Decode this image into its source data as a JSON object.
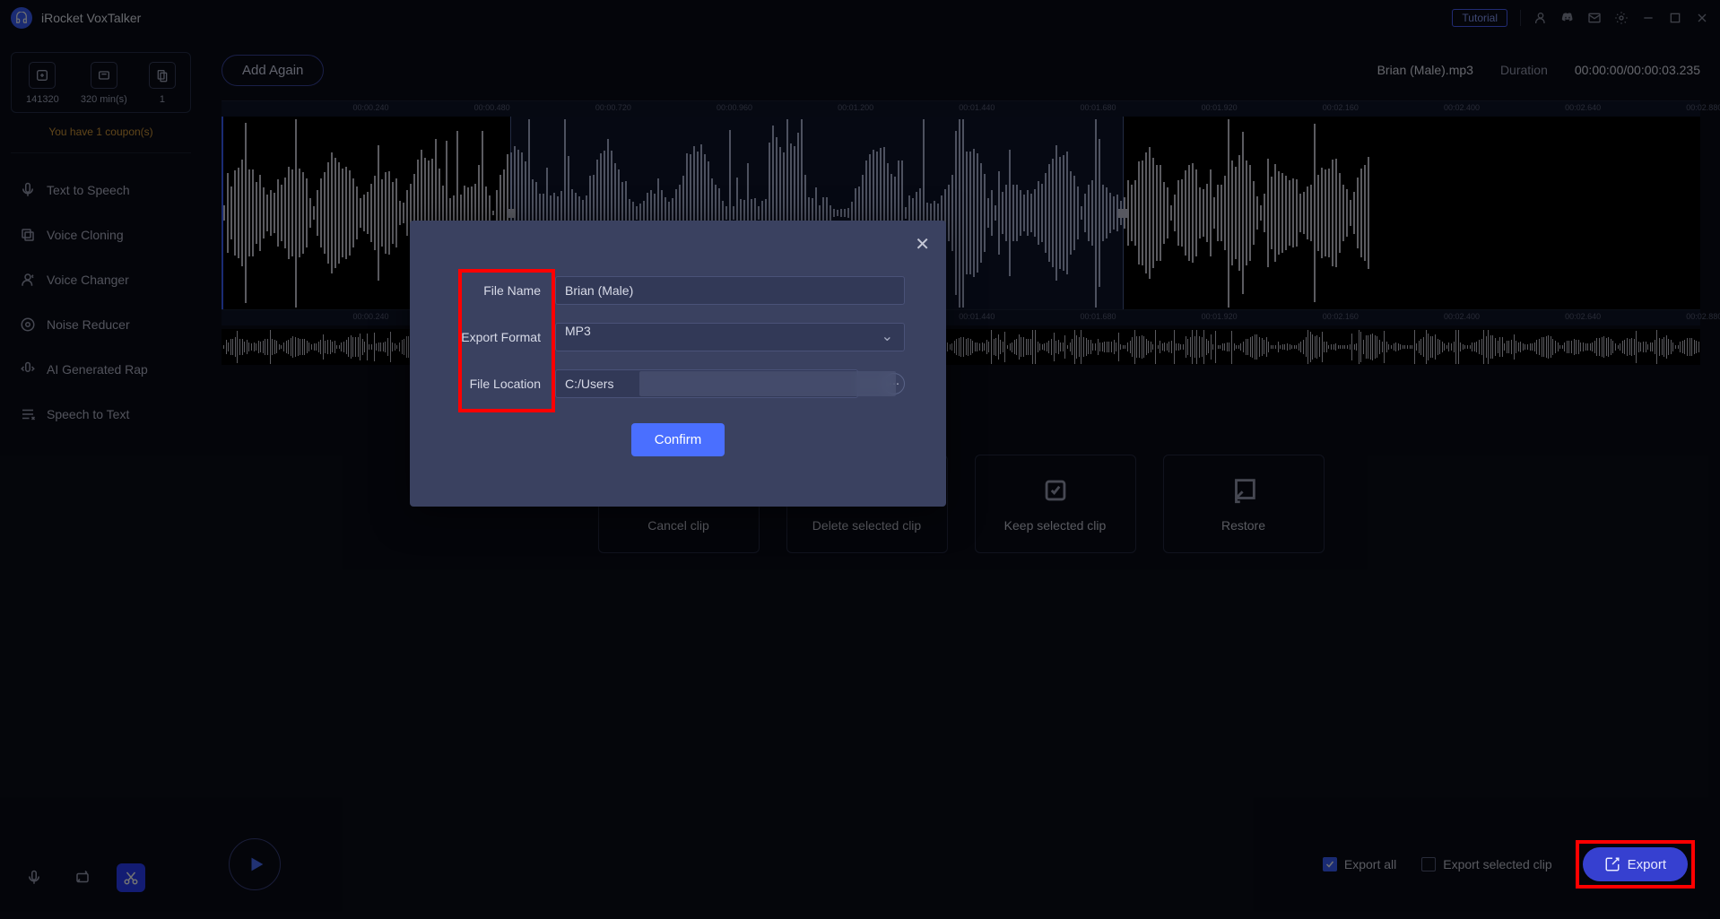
{
  "app_title": "iRocket VoxTalker",
  "titlebar": {
    "tutorial": "Tutorial"
  },
  "sidebar": {
    "stats": [
      {
        "value": "141320"
      },
      {
        "value": "320 min(s)"
      },
      {
        "value": "1"
      }
    ],
    "coupon": "You have 1 coupon(s)",
    "items": [
      {
        "label": "Text to Speech"
      },
      {
        "label": "Voice Cloning"
      },
      {
        "label": "Voice Changer"
      },
      {
        "label": "Noise Reducer"
      },
      {
        "label": "AI Generated Rap"
      },
      {
        "label": "Speech to Text"
      }
    ]
  },
  "header": {
    "add_again": "Add Again",
    "file_name": "Brian (Male).mp3",
    "duration_label": "Duration",
    "duration_value": "00:00:00/00:00:03.235"
  },
  "timeline_ticks": [
    "00:00.240",
    "00:00.480",
    "00:00.720",
    "00:00.960",
    "00:01.200",
    "00:01.440",
    "00:01.680",
    "00:01.920",
    "00:02.160",
    "00:02.400",
    "00:02.640",
    "00:02.880"
  ],
  "actions": {
    "cancel": "Cancel clip",
    "delete": "Delete selected clip",
    "keep": "Keep selected clip",
    "restore": "Restore"
  },
  "footer": {
    "export_all": "Export all",
    "export_selected": "Export selected clip",
    "export_btn": "Export"
  },
  "modal": {
    "labels": {
      "name": "File Name",
      "format": "Export Format",
      "location": "File Location"
    },
    "file_name": "Brian (Male)",
    "format": "MP3",
    "location": "C:/Users",
    "confirm": "Confirm"
  }
}
